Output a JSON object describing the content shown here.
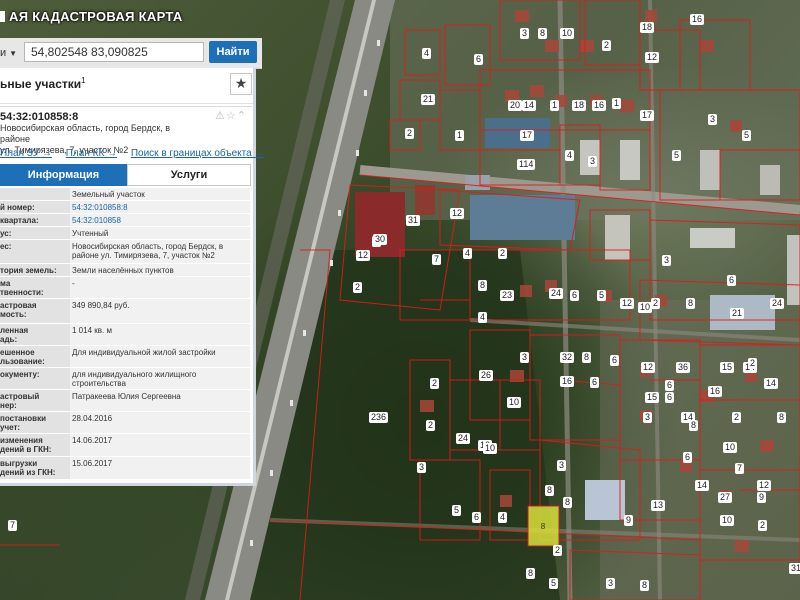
{
  "map": {
    "title": "АЯ КАДАСТРОВАЯ КАРТА",
    "parcel_labels": [
      "4",
      "6",
      "3",
      "8",
      "10",
      "2",
      "12",
      "18",
      "16",
      "21",
      "2",
      "1",
      "20",
      "14",
      "1",
      "18",
      "17",
      "16",
      "1",
      "114",
      "4",
      "3",
      "17",
      "5",
      "3",
      "5",
      "31",
      "6",
      "12",
      "4",
      "2",
      "8",
      "23",
      "24",
      "6",
      "5",
      "3",
      "6",
      "8",
      "10",
      "21",
      "12",
      "2",
      "4",
      "7",
      "12",
      "30",
      "2",
      "2",
      "26",
      "10",
      "3",
      "32",
      "8",
      "16",
      "6",
      "12",
      "36",
      "15",
      "14",
      "14",
      "3",
      "14",
      "2",
      "8",
      "10",
      "2",
      "24",
      "10",
      "3",
      "8",
      "15",
      "6",
      "8",
      "10",
      "27",
      "2",
      "10",
      "7",
      "3",
      "5",
      "6",
      "4",
      "8",
      "9",
      "13",
      "6",
      "16",
      "236",
      "3",
      "5",
      "8",
      "2",
      "6",
      "6",
      "31",
      "12",
      "9",
      "8",
      "7",
      "24",
      "2",
      "14"
    ]
  },
  "search": {
    "selector_label": "и",
    "input_value": "54,802548 83,090825",
    "button_label": "Найти"
  },
  "panel": {
    "title": "ьные участки",
    "title_sup": "1",
    "star_label": "★"
  },
  "object": {
    "number": "54:32:010858:8",
    "icons": "⚠☆⌃",
    "address_line1": "Новосибирская область, город Бердск, в районе",
    "address_line2": "ул. Тимирязева, 7, участок №2",
    "links": [
      "План ЗУ →",
      "План КК →",
      "Поиск в границах объекта →"
    ]
  },
  "tabs": {
    "info": "Информация",
    "services": "Услуги"
  },
  "info_rows": [
    {
      "key": "",
      "value": "Земельный участок",
      "link": false,
      "h": 13
    },
    {
      "key": "й номер:",
      "value": "54:32:010858:8",
      "link": true,
      "h": 13
    },
    {
      "key": "квартала:",
      "value": "54:32:010858",
      "link": true,
      "h": 13
    },
    {
      "key": "ус:",
      "value": "Учтенный",
      "link": false,
      "h": 13
    },
    {
      "key": "ес:",
      "value": "Новосибирская область, город Бердск, в районе ул. Тимирязева, 7, участок №2",
      "link": false,
      "h": 24
    },
    {
      "key": "тория земель:",
      "value": "Земли населённых пунктов",
      "link": false,
      "h": 13
    },
    {
      "key": "ма\nтвенности:",
      "value": "-",
      "link": false,
      "h": 22
    },
    {
      "key": "астровая\nмость:",
      "value": "349 890,84 руб.",
      "link": false,
      "h": 25
    },
    {
      "key": "ленная\nадь:",
      "value": "1 014 кв. м",
      "link": false,
      "h": 22
    },
    {
      "key": "ешенное\nльзование:",
      "value": "Для индивидуальной жилой застройки",
      "link": false,
      "h": 22
    },
    {
      "key": "окументу:",
      "value": "для индивидуального жилищного строительства",
      "link": false,
      "h": 22
    },
    {
      "key": "астровый\nнер:",
      "value": "Патракеева Юлия Сергеевна",
      "link": false,
      "h": 22
    },
    {
      "key": "постановки\nучет:",
      "value": "28.04.2016",
      "link": false,
      "h": 22
    },
    {
      "key": "изменения\nдений в ГКН:",
      "value": "14.06.2017",
      "link": false,
      "h": 23
    },
    {
      "key": "выгрузки\nдений из ГКН:",
      "value": "15.06.2017",
      "link": false,
      "h": 23
    }
  ]
}
